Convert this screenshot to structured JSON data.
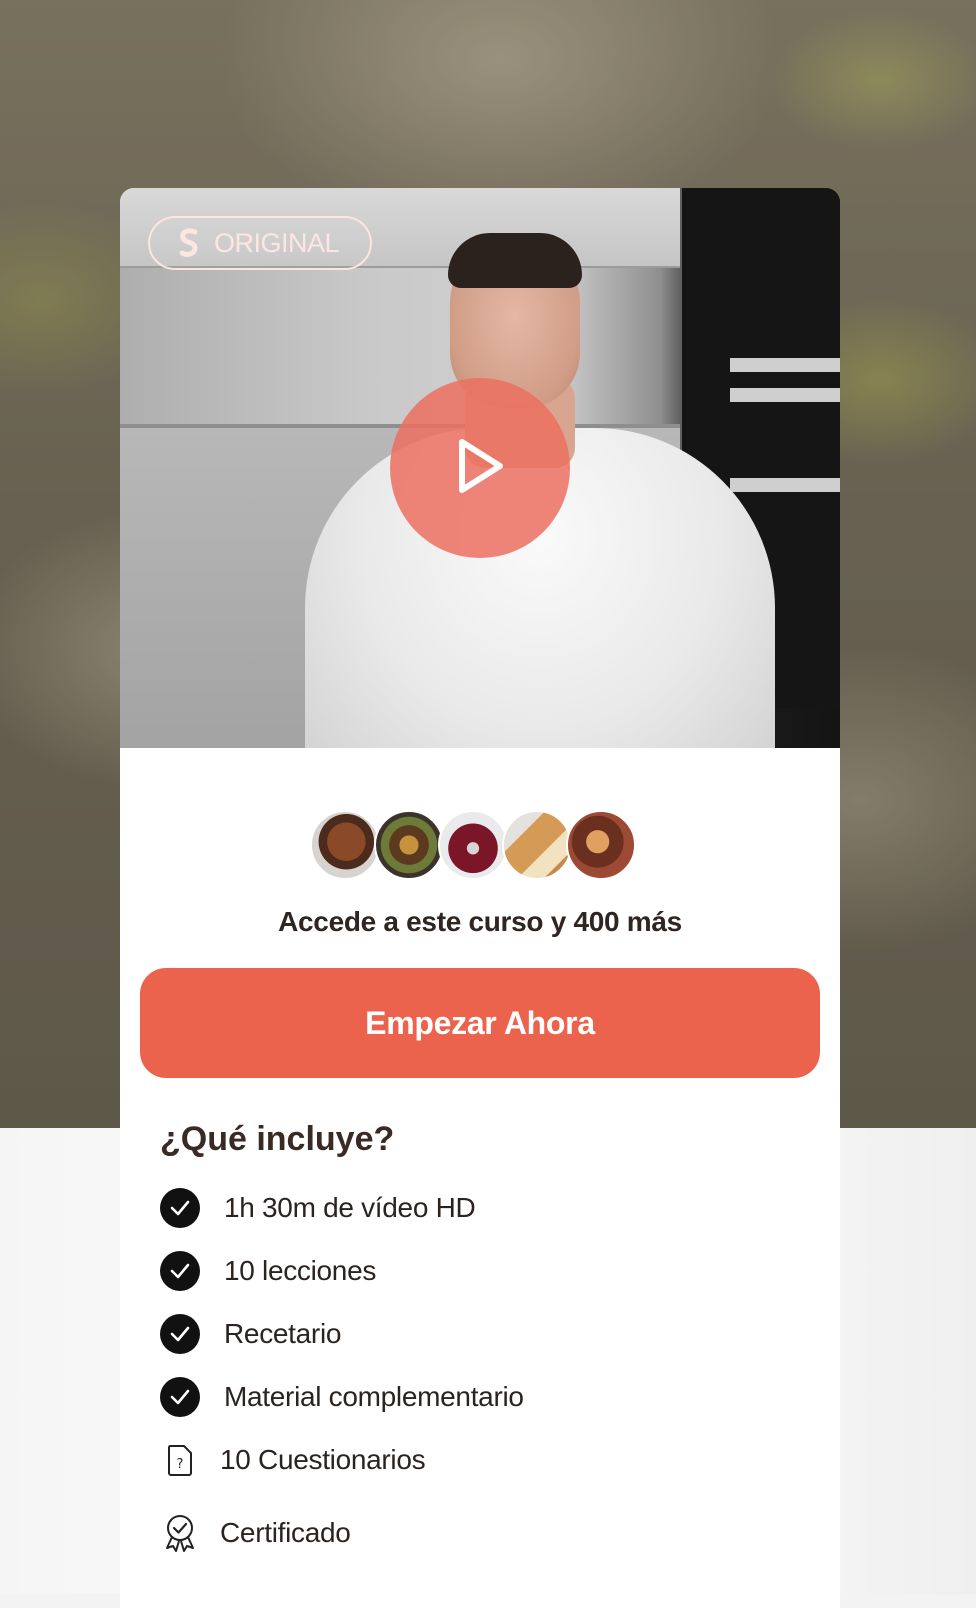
{
  "video": {
    "badge_label": "ORIGINAL",
    "badge_icon": "s-logo-icon",
    "play_icon": "play-icon"
  },
  "course_access": {
    "headline": "Accede a este curso y 400 más",
    "avatars": [
      "bread-avatar",
      "burger-avatar",
      "donut-avatar",
      "toast-avatar",
      "pastry-avatar"
    ]
  },
  "cta": {
    "label": "Empezar Ahora"
  },
  "includes": {
    "title": "¿Qué incluye?",
    "items": [
      {
        "label": "1h 30m de vídeo HD",
        "icon": "check-circle-icon"
      },
      {
        "label": "10 lecciones",
        "icon": "check-circle-icon"
      },
      {
        "label": "Recetario",
        "icon": "check-circle-icon"
      },
      {
        "label": "Material complementario",
        "icon": "check-circle-icon"
      },
      {
        "label": "10 Cuestionarios",
        "icon": "quiz-document-icon"
      },
      {
        "label": "Certificado",
        "icon": "certificate-icon"
      }
    ]
  },
  "colors": {
    "accent": "#eb634c",
    "play_overlay": "#ec7060",
    "text_dark": "#2f2521"
  }
}
